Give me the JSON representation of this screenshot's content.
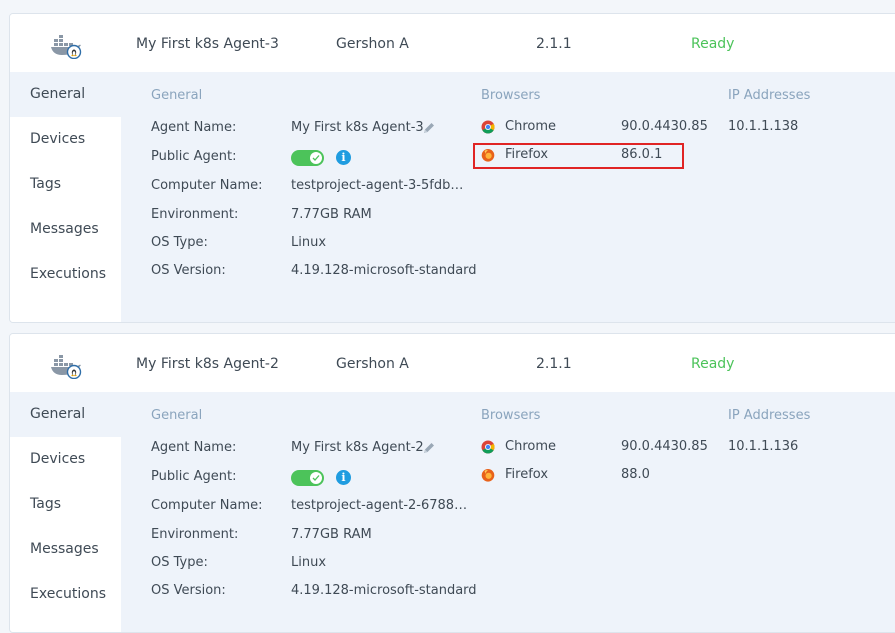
{
  "agents": [
    {
      "header": {
        "name": "My First k8s Agent-3",
        "owner": "Gershon A",
        "version": "2.1.1",
        "status": "Ready"
      },
      "nav": [
        "General",
        "Devices",
        "Tags",
        "Messages",
        "Executions"
      ],
      "sections": {
        "general": "General",
        "browsers": "Browsers",
        "ip": "IP Addresses"
      },
      "fields": {
        "agent_name_label": "Agent Name:",
        "agent_name": "My First k8s Agent-3",
        "public_agent_label": "Public Agent:",
        "computer_name_label": "Computer Name:",
        "computer_name": "testproject-agent-3-5fdb…",
        "environment_label": "Environment:",
        "environment": "7.77GB RAM",
        "os_type_label": "OS Type:",
        "os_type": "Linux",
        "os_version_label": "OS Version:",
        "os_version": "4.19.128-microsoft-standard"
      },
      "browsers": [
        {
          "name": "Chrome",
          "version": "90.0.4430.85",
          "icon": "chrome-icon"
        },
        {
          "name": "Firefox",
          "version": "86.0.1",
          "icon": "firefox-icon"
        }
      ],
      "ip_addresses": "10.1.1.138"
    },
    {
      "header": {
        "name": "My First k8s Agent-2",
        "owner": "Gershon A",
        "version": "2.1.1",
        "status": "Ready"
      },
      "nav": [
        "General",
        "Devices",
        "Tags",
        "Messages",
        "Executions"
      ],
      "sections": {
        "general": "General",
        "browsers": "Browsers",
        "ip": "IP Addresses"
      },
      "fields": {
        "agent_name_label": "Agent Name:",
        "agent_name": "My First k8s Agent-2",
        "public_agent_label": "Public Agent:",
        "computer_name_label": "Computer Name:",
        "computer_name": "testproject-agent-2-6788…",
        "environment_label": "Environment:",
        "environment": "7.77GB RAM",
        "os_type_label": "OS Type:",
        "os_type": "Linux",
        "os_version_label": "OS Version:",
        "os_version": "4.19.128-microsoft-standard"
      },
      "browsers": [
        {
          "name": "Chrome",
          "version": "90.0.4430.85",
          "icon": "chrome-icon"
        },
        {
          "name": "Firefox",
          "version": "88.0",
          "icon": "firefox-icon"
        }
      ],
      "ip_addresses": "10.1.1.136"
    }
  ],
  "colors": {
    "status_ready": "#4cc35a",
    "section_title": "#8aa4bd",
    "highlight": "#e02424",
    "toggle_on": "#4cc35a",
    "info": "#1f9ce0"
  }
}
